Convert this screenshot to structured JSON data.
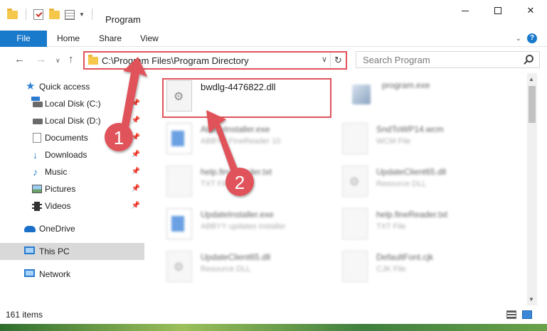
{
  "window": {
    "title": "Program",
    "controls": [
      "minimize",
      "maximize",
      "close"
    ]
  },
  "ribbon": {
    "tabs": [
      {
        "label": "File"
      },
      {
        "label": "Home"
      },
      {
        "label": "Share"
      },
      {
        "label": "View"
      }
    ]
  },
  "navigation": {
    "address": "C:\\Program Files\\Program Directory",
    "search_placeholder": "Search Program"
  },
  "sidebar": {
    "items": [
      {
        "label": "Quick access",
        "icon": "star-icon"
      },
      {
        "label": "Local Disk (C:)",
        "icon": "drive-icon",
        "pinned": true
      },
      {
        "label": "Local Disk (D:)",
        "icon": "drive-icon",
        "pinned": true
      },
      {
        "label": "Documents",
        "icon": "documents-icon",
        "pinned": true
      },
      {
        "label": "Downloads",
        "icon": "downloads-icon",
        "pinned": true
      },
      {
        "label": "Music",
        "icon": "music-icon",
        "pinned": true
      },
      {
        "label": "Pictures",
        "icon": "pictures-icon",
        "pinned": true
      },
      {
        "label": "Videos",
        "icon": "videos-icon",
        "pinned": true
      },
      {
        "label": "OneDrive",
        "icon": "onedrive-icon"
      },
      {
        "label": "This PC",
        "icon": "pc-icon",
        "selected": true
      },
      {
        "label": "Network",
        "icon": "network-icon"
      }
    ]
  },
  "files": [
    {
      "name": "bwdlg-4476822.dll",
      "type": "",
      "icon": "dll-gear-icon",
      "highlighted": true
    },
    {
      "name": "program.exe",
      "type": "",
      "icon": "exe-icon"
    },
    {
      "name": "AbbyyInstaller.exe",
      "type": "ABBYY FineReader 10",
      "icon": "installer-icon"
    },
    {
      "name": "SndToWP14.wcm",
      "type": "WCM File",
      "icon": "file-icon"
    },
    {
      "name": "help.fineReader.txt",
      "type": "TXT File",
      "icon": "file-icon"
    },
    {
      "name": "UpdateClient65.dll",
      "type": "Resource DLL",
      "icon": "dll-gear-icon"
    },
    {
      "name": "UpdateInstaller.exe",
      "type": "ABBYY updates installer",
      "icon": "installer-icon"
    },
    {
      "name": "help.fineReader.txt",
      "type": "TXT File",
      "icon": "file-icon"
    },
    {
      "name": "UpdateClient65.dll",
      "type": "Resource DLL",
      "icon": "dll-gear-icon"
    },
    {
      "name": "DefaultFont.cjk",
      "type": "CJK File",
      "icon": "file-icon"
    }
  ],
  "status": {
    "item_count": "161 items"
  },
  "annotations": {
    "step1": "1",
    "step2": "2",
    "color": "#e0525a"
  }
}
